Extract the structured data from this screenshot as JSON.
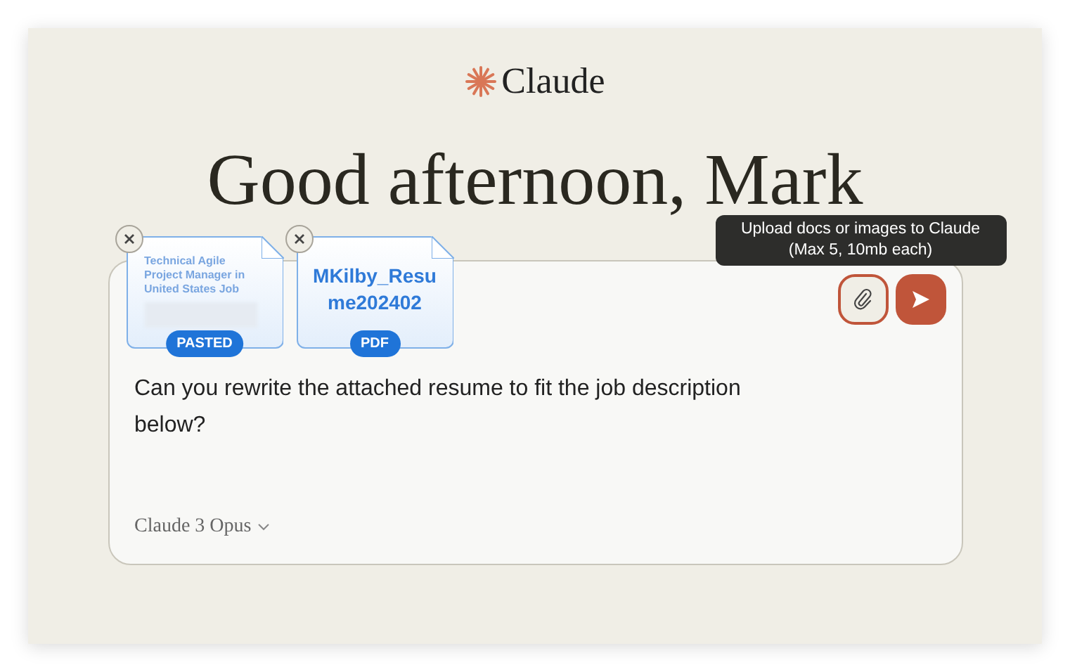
{
  "logo": {
    "text": "Claude"
  },
  "greeting": "Good afternoon, Mark",
  "attachments": [
    {
      "kind": "pasted",
      "text": "Technical Agile Project Manager in United States Job",
      "badge": "PASTED"
    },
    {
      "kind": "file",
      "text": "MKilby_Resume202402",
      "badge": "PDF"
    }
  ],
  "tooltip": {
    "text": "Upload docs or images to Claude",
    "subtext": "(Max 5, 10mb each)"
  },
  "attach_button": {
    "highlighted": true
  },
  "message": "Can you rewrite the attached resume to fit the job description below?",
  "model": "Claude 3 Opus"
}
